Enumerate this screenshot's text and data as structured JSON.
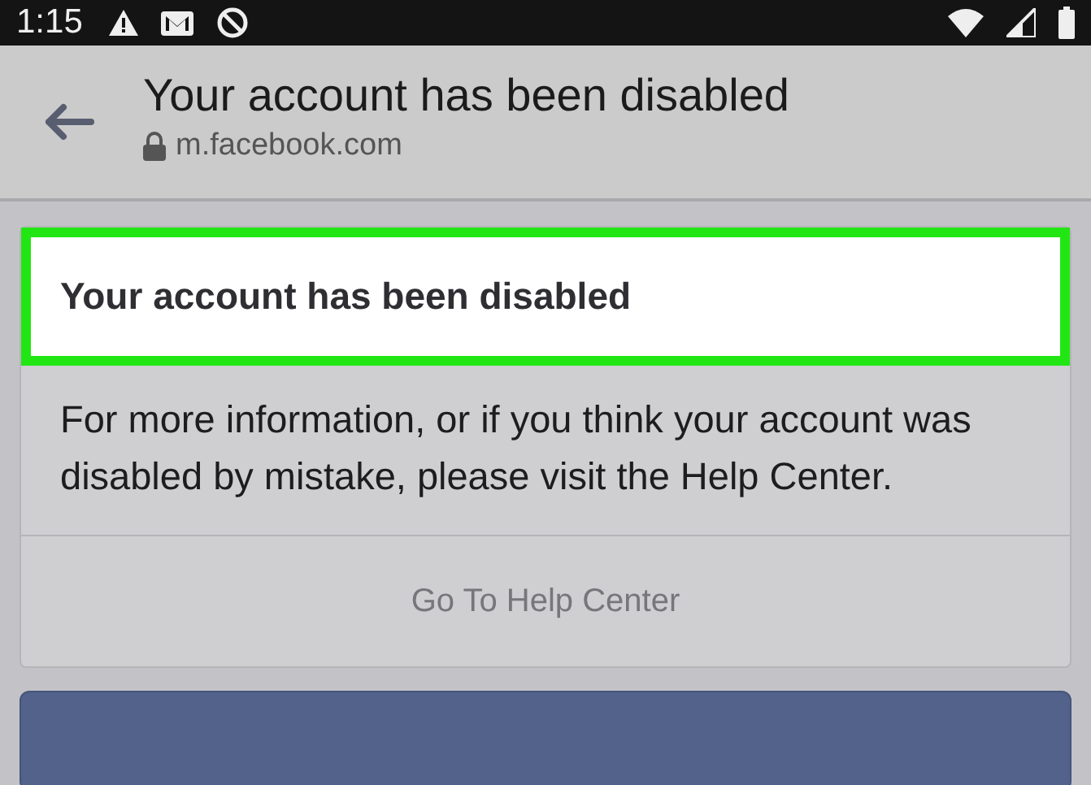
{
  "status_bar": {
    "time": "1:15"
  },
  "header": {
    "title": "Your account has been disabled",
    "url": "m.facebook.com"
  },
  "card": {
    "title": "Your account has been disabled",
    "highlighted": true,
    "message": "For more information, or if you think your account was disabled by mistake, please visit the Help Center.",
    "button": "Go To Help Center"
  }
}
